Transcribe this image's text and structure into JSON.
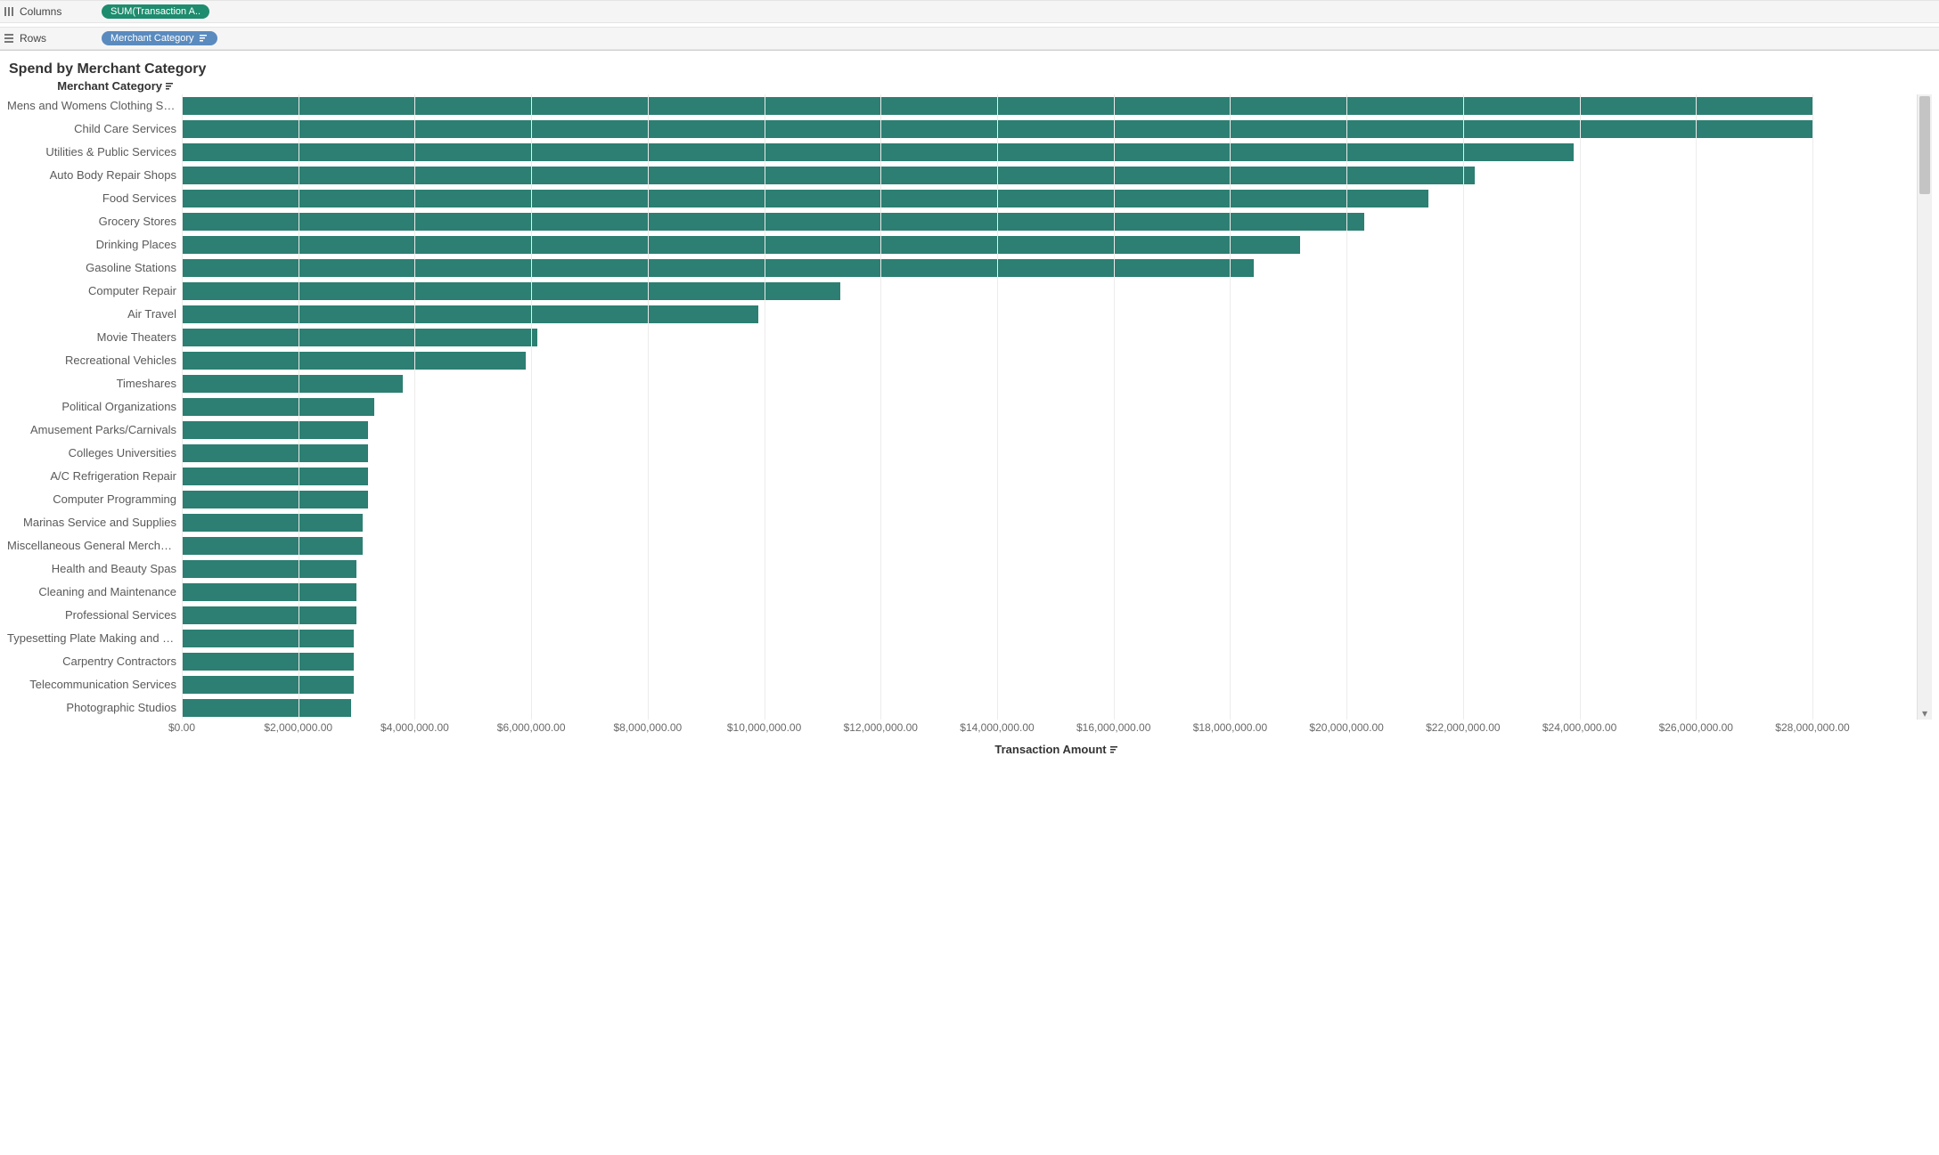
{
  "shelves": {
    "columns_label": "Columns",
    "rows_label": "Rows",
    "columns_pill": "SUM(Transaction A..",
    "rows_pill": "Merchant Category"
  },
  "chart_data": {
    "type": "bar",
    "title": "Spend by Merchant Category",
    "category_axis_title": "Merchant Category",
    "value_axis_title": "Transaction Amount",
    "value_format": "currency_usd",
    "xlim": [
      0,
      28000000
    ],
    "x_tick_interval": 2000000,
    "x_ticks": [
      "$0.00",
      "$2,000,000.00",
      "$4,000,000.00",
      "$6,000,000.00",
      "$8,000,000.00",
      "$10,000,000.00",
      "$12,000,000.00",
      "$14,000,000.00",
      "$16,000,000.00",
      "$18,000,000.00",
      "$20,000,000.00",
      "$22,000,000.00",
      "$24,000,000.00",
      "$26,000,000.00",
      "$28,000,000.00"
    ],
    "sort": "descending_by_value",
    "bar_color": "#2c7f72",
    "categories": [
      "Mens and Womens Clothing Stores",
      "Child Care Services",
      "Utilities & Public Services",
      "Auto Body Repair Shops",
      "Food Services",
      "Grocery Stores",
      "Drinking Places",
      "Gasoline Stations",
      "Computer Repair",
      "Air Travel",
      "Movie Theaters",
      "Recreational Vehicles",
      "Timeshares",
      "Political Organizations",
      "Amusement Parks/Carnivals",
      "Colleges Universities",
      "A/C Refrigeration Repair",
      "Computer Programming",
      "Marinas Service and Supplies",
      "Miscellaneous General Merchandise",
      "Health and Beauty Spas",
      "Cleaning and Maintenance",
      "Professional Services",
      "Typesetting Plate Making and Relate..",
      "Carpentry Contractors",
      "Telecommunication Services",
      "Photographic Studios"
    ],
    "values": [
      28000000,
      28000000,
      23900000,
      22200000,
      21400000,
      20300000,
      19200000,
      18400000,
      11300000,
      9900000,
      6100000,
      5900000,
      3800000,
      3300000,
      3200000,
      3200000,
      3200000,
      3200000,
      3100000,
      3100000,
      3000000,
      3000000,
      3000000,
      2950000,
      2950000,
      2950000,
      2900000
    ]
  }
}
